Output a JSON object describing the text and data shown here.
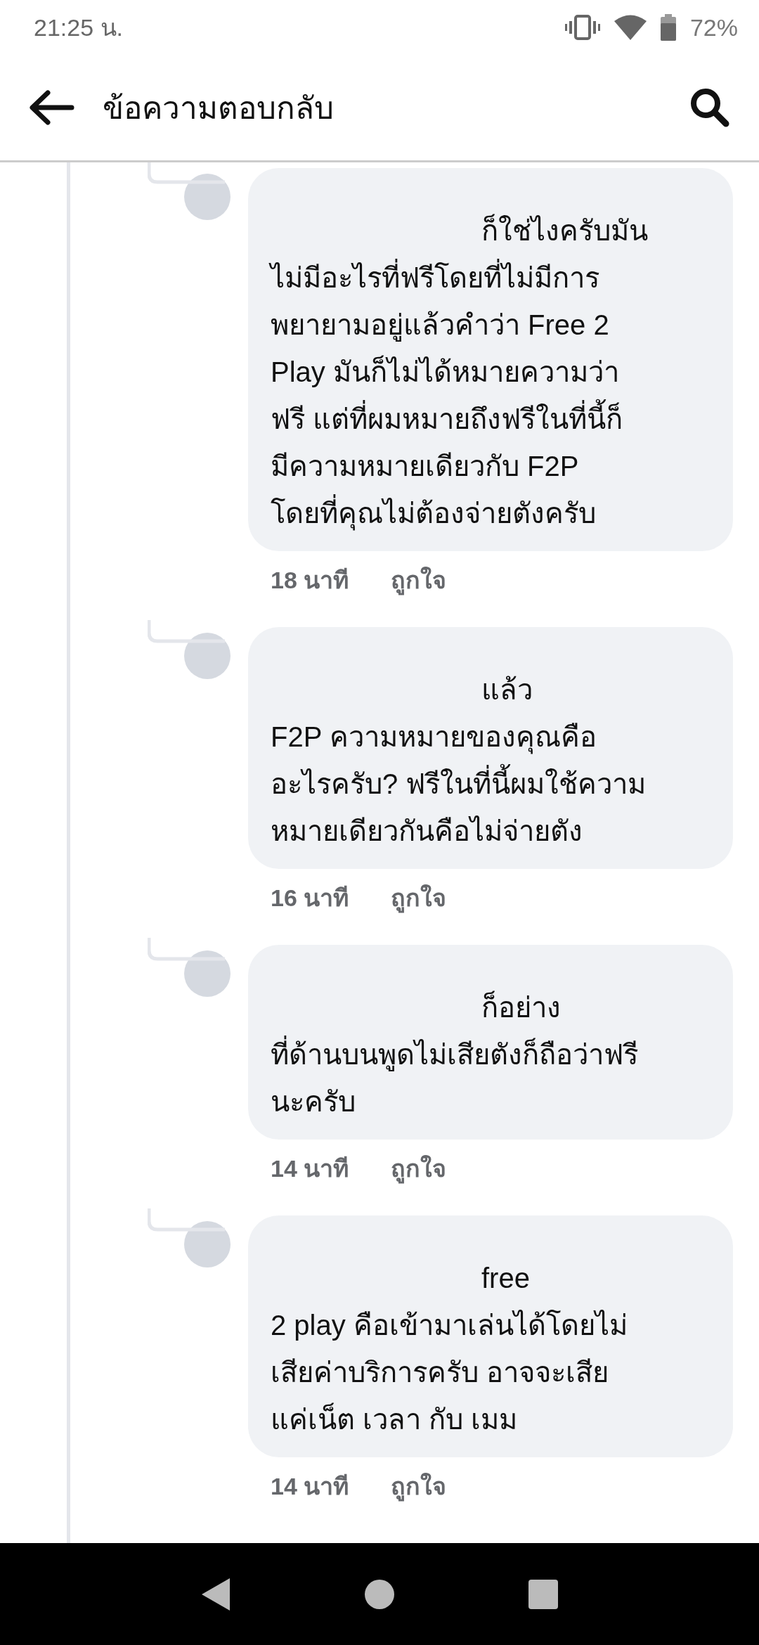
{
  "status_bar": {
    "time": "21:25 น.",
    "battery": "72%"
  },
  "header": {
    "title": "ข้อความตอบกลับ"
  },
  "comments": [
    {
      "text": "ก็ใช่ไงครับมัน\nไม่มีอะไรที่ฟรีโดยที่ไม่มีการ\nพยายามอยู่แล้วคำว่า Free 2\nPlay มันก็ไม่ได้หมายความว่า\nฟรี แต่ที่ผมหมายถึงฟรีในที่นี้ก็\nมีความหมายเดียวกับ F2P\nโดยที่คุณไม่ต้องจ่ายตังครับ",
      "time": "18 นาที",
      "like": "ถูกใจ"
    },
    {
      "text": "แล้ว\nF2P ความหมายของคุณคือ\nอะไรครับ? ฟรีในที่นี้ผมใช้ความ\nหมายเดียวกันคือไม่จ่ายตัง",
      "time": "16 นาที",
      "like": "ถูกใจ"
    },
    {
      "text": "ก็อย่าง\nที่ด้านบนพูดไม่เสียตังก็ถือว่าฟรี\nนะครับ",
      "time": "14 นาที",
      "like": "ถูกใจ"
    },
    {
      "text": "free\n2 play คือเข้ามาเล่นได้โดยไม่\nเสียค่าบริการครับ อาจจะเสีย\nแค่เน็ต เวลา กับ เมม",
      "time": "14 นาที",
      "like": "ถูกใจ"
    }
  ]
}
